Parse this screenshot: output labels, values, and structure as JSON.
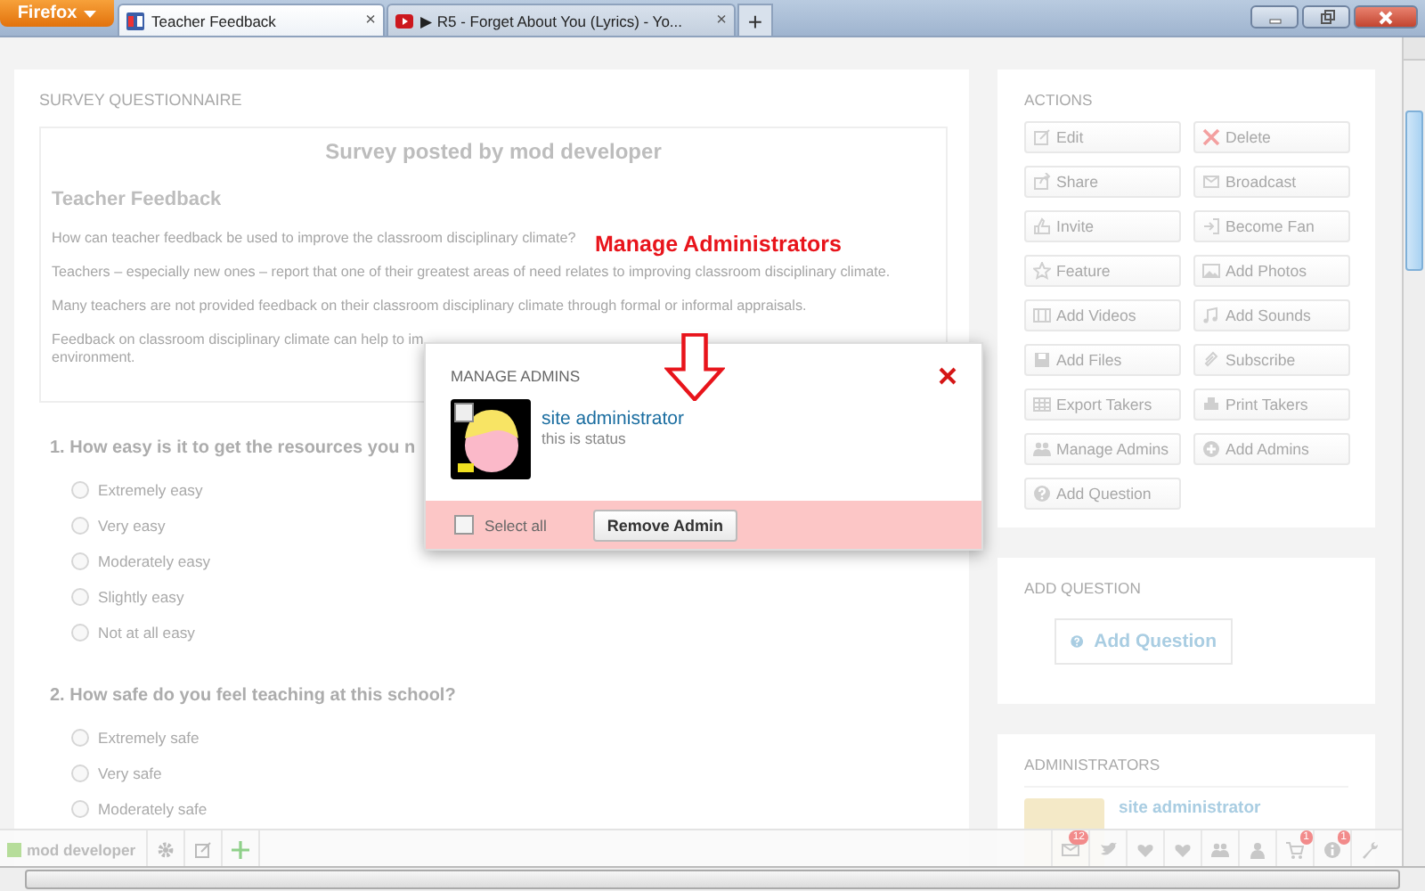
{
  "browser": {
    "menu_button": "Firefox",
    "new_tab": "+",
    "tabs": [
      {
        "title": "Teacher Feedback",
        "close": "×",
        "selected": true
      },
      {
        "title": "▶ R5 - Forget About You (Lyrics) - Yo...",
        "close": "×",
        "selected": false
      }
    ]
  },
  "survey": {
    "section_title": "SURVEY QUESTIONNAIRE",
    "posted_by": "Survey posted by mod developer",
    "title": "Teacher Feedback",
    "paragraphs": [
      {
        "lines": [
          "How can teacher feedback be used to improve the classroom disciplinary climate?"
        ]
      },
      {
        "lines": [
          "Teachers – especially new ones – report that one of their greatest areas of need relates to improving classroom disciplinary climate."
        ]
      },
      {
        "lines": [
          "Many teachers are not provided feedback on their classroom disciplinary climate through formal or informal appraisals."
        ]
      },
      {
        "lines": [
          "Feedback on classroom disciplinary climate can help to im",
          "environment."
        ]
      }
    ],
    "questions": [
      {
        "text": "1. How easy is it to get the resources you n",
        "options": [
          {
            "label": "Extremely easy",
            "selected": false
          },
          {
            "label": "Very easy",
            "selected": false
          },
          {
            "label": "Moderately easy",
            "selected": false
          },
          {
            "label": "Slightly easy",
            "selected": false
          },
          {
            "label": "Not at all easy",
            "selected": false
          }
        ]
      },
      {
        "text": "2. How safe do you feel teaching at this school?",
        "options": [
          {
            "label": "Extremely safe",
            "selected": false
          },
          {
            "label": "Very safe",
            "selected": false
          },
          {
            "label": "Moderately safe",
            "selected": false
          }
        ]
      }
    ]
  },
  "actions": {
    "title": "ACTIONS",
    "buttons": [
      "Edit",
      "Delete",
      "Share",
      "Broadcast",
      "Invite",
      "Become Fan",
      "Feature",
      "Add Photos",
      "Add Videos",
      "Add Sounds",
      "Add Files",
      "Subscribe",
      "Export Takers",
      "Print Takers",
      "Manage Admins",
      "Add Admins",
      "Add Question"
    ]
  },
  "add_question": {
    "title": "ADD QUESTION",
    "button": "Add Question"
  },
  "administrators": {
    "title": "ADMINISTRATORS",
    "name": "site administrator"
  },
  "annotation": {
    "text": "Manage Administrators"
  },
  "modal": {
    "title": "MANAGE ADMINS",
    "admins": [
      {
        "name": "site administrator",
        "status": "this is status",
        "checked": false
      }
    ],
    "select_all": {
      "label": "Select all",
      "checked": false
    },
    "button": "Remove Admin"
  },
  "toolbar": {
    "user": "mod developer",
    "mail_badge": "12",
    "cart_badge": "1",
    "info_badge": "1"
  }
}
